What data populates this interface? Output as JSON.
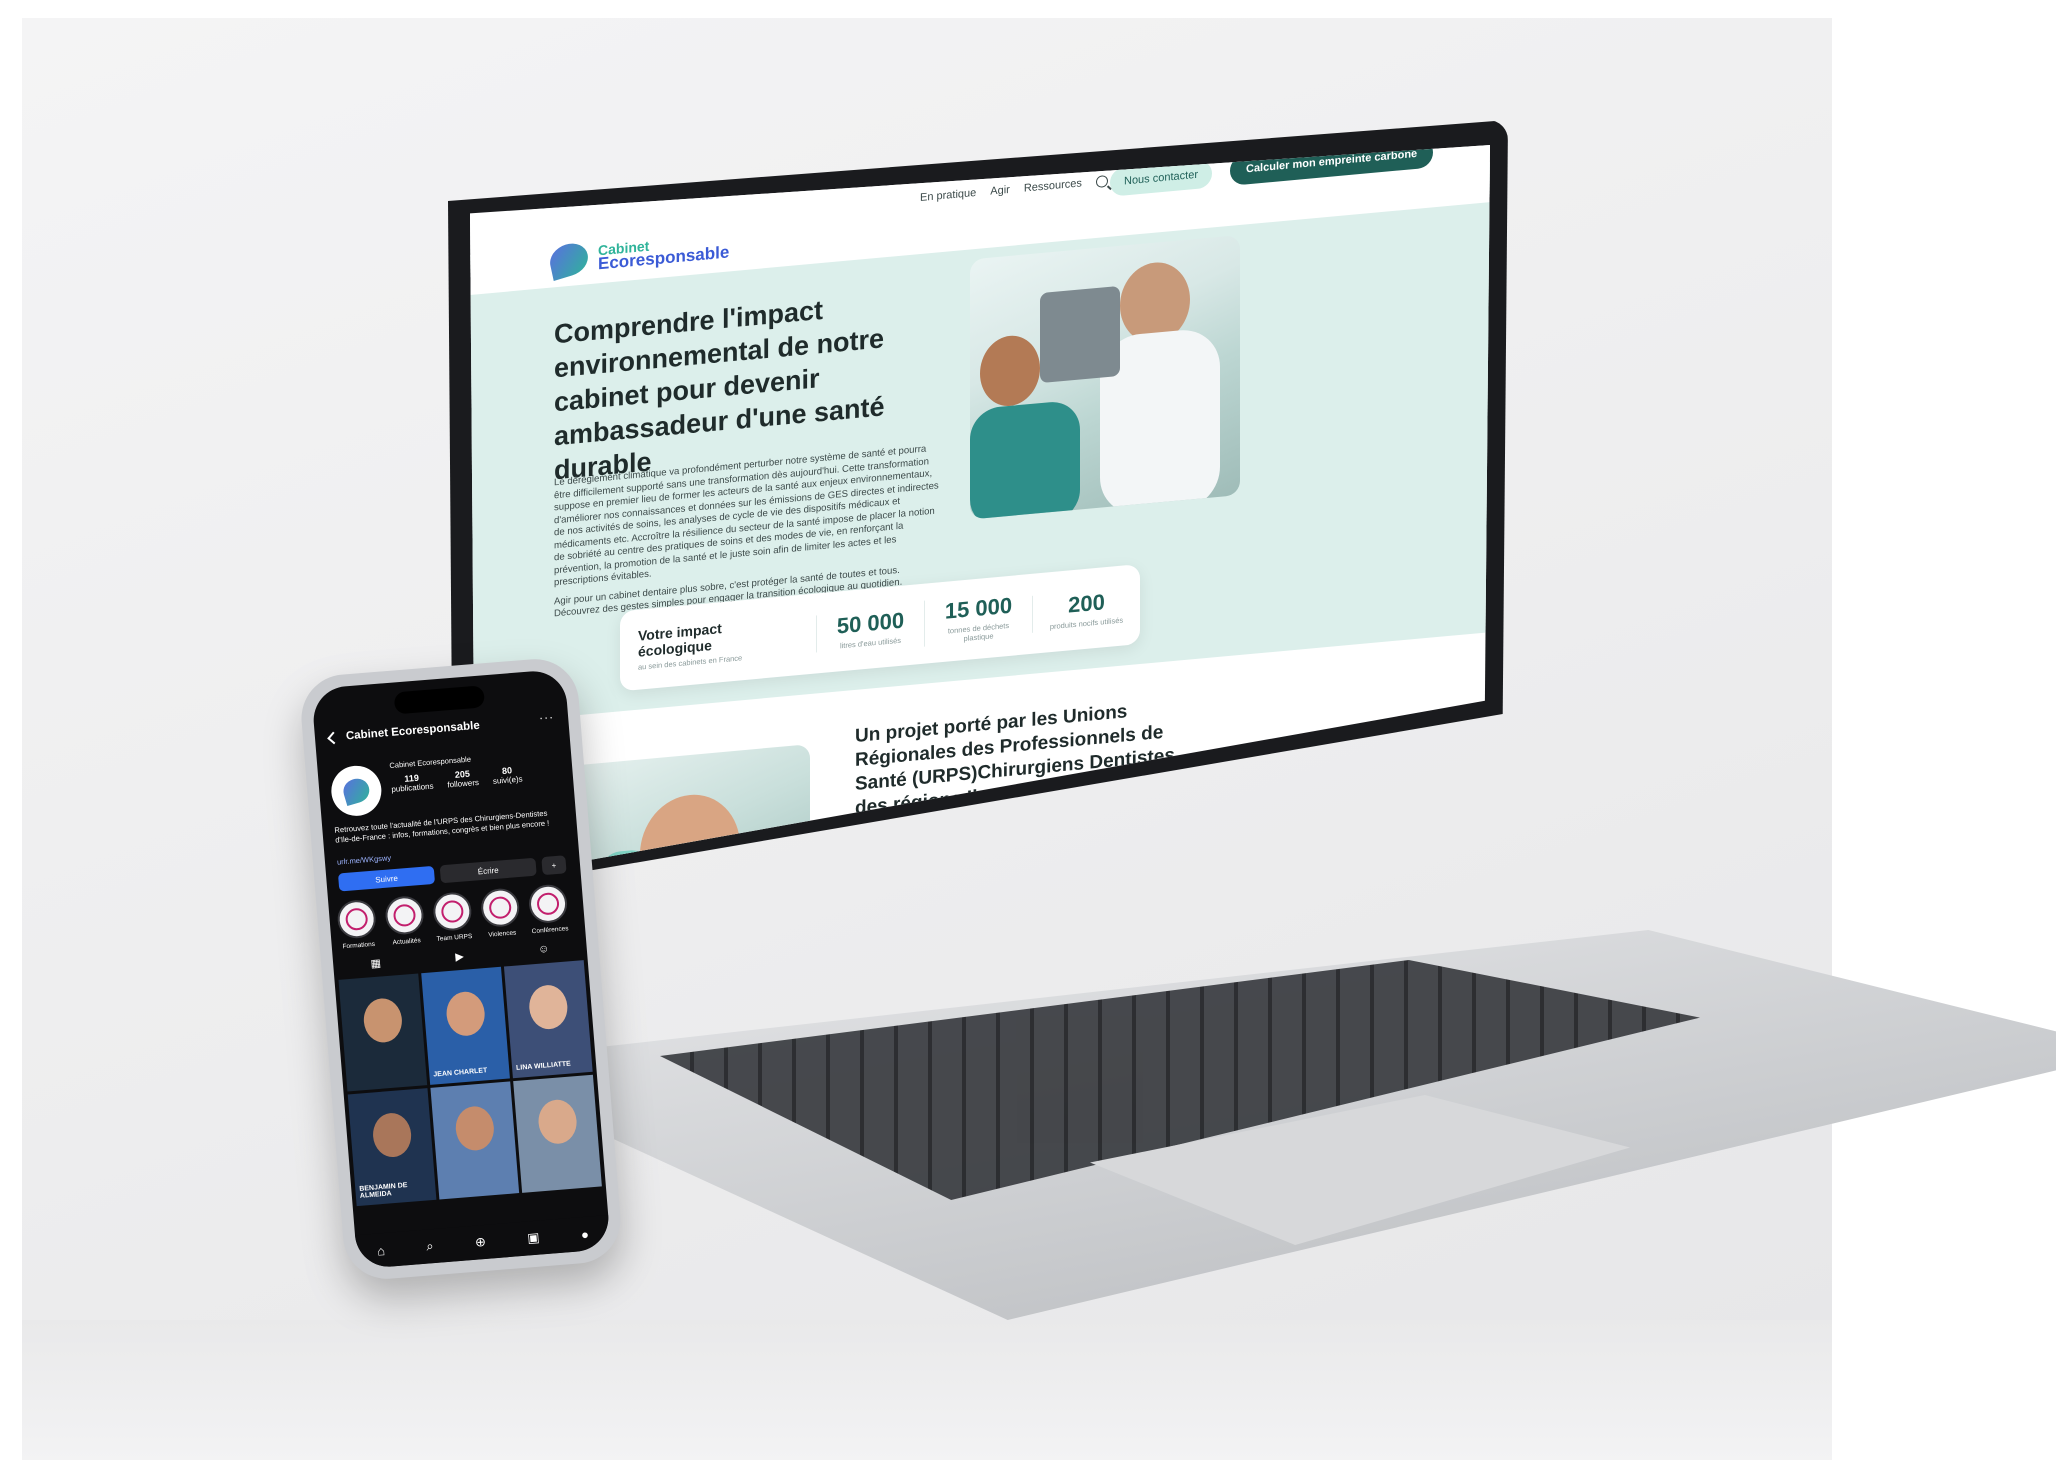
{
  "site": {
    "logo": {
      "line1": "Cabinet",
      "line2": "Ecoresponsable"
    },
    "nav": [
      "En pratique",
      "Agir",
      "Ressources"
    ],
    "search_icon": "search-icon",
    "contact_button": "Nous contacter",
    "carbon_button": "Calculer mon empreinte carbone",
    "hero": {
      "title": "Comprendre l'impact environnemental de notre cabinet pour devenir ambassadeur d'une santé durable",
      "paragraph1": "Le dérèglement climatique va profondément perturber notre système de santé et pourra être difficilement supporté sans une transformation dès aujourd'hui. Cette transformation suppose en premier lieu de former les acteurs de la santé aux enjeux environnementaux, d'améliorer nos connaissances et données sur les émissions de GES directes et indirectes de nos activités de soins, les analyses de cycle de vie des dispositifs médicaux et médicaments etc. Accroître la résilience du secteur de la santé impose de placer la notion de sobriété au centre des pratiques de soins et des modes de vie, en renforçant la prévention, la promotion de la santé et le juste soin afin de limiter les actes et les prescriptions évitables.",
      "paragraph2": "Agir pour un cabinet dentaire plus sobre, c'est protéger la santé de toutes et tous. Découvrez des gestes simples pour engager la transition écologique au quotidien."
    },
    "stats": {
      "title": "Votre impact écologique",
      "subtitle": "au sein des cabinets en France",
      "items": [
        {
          "value": "50 000",
          "label": "litres d'eau utilisés"
        },
        {
          "value": "15 000",
          "label": "tonnes de déchets plastique"
        },
        {
          "value": "200",
          "label": "produits nocifs utilisés"
        }
      ]
    },
    "project_title": "Un projet porté par les Unions Régionales des Professionnels de Santé (URPS)Chirurgiens Dentistes des régions Ile- de-France, Auvergne-Rhône-Alpes et Provence-Alpes-Côte-d'Azur"
  },
  "instagram": {
    "header": "Cabinet Ecoresponsable",
    "account_name": "Cabinet Ecoresponsable",
    "counts": [
      {
        "value": "119",
        "label": "publications"
      },
      {
        "value": "205",
        "label": "followers"
      },
      {
        "value": "80",
        "label": "suivi(e)s"
      }
    ],
    "bio": "Retrouvez toute l'actualité de l'URPS des Chirurgiens-Dentistes d'Ile-de-France : infos, formations, congrès et bien plus encore !",
    "link": "urlr.me/WKgswy",
    "follow_button": "Suivre",
    "write_button": "Écrire",
    "highlights": [
      "Formations",
      "Actualités",
      "Team URPS",
      "Violences",
      "Conférences"
    ],
    "posts": [
      {
        "caption": ""
      },
      {
        "caption": "JEAN CHARLET"
      },
      {
        "caption": "LINA WILLIATTE"
      },
      {
        "caption": "BENJAMIN DE ALMEIDA"
      },
      {
        "caption": ""
      },
      {
        "caption": ""
      }
    ]
  },
  "colors": {
    "brand_teal": "#1f5f57",
    "mint": "#dcefeb",
    "brand_blue": "#3b5bd6",
    "instagram_blue": "#2f6ef2"
  }
}
